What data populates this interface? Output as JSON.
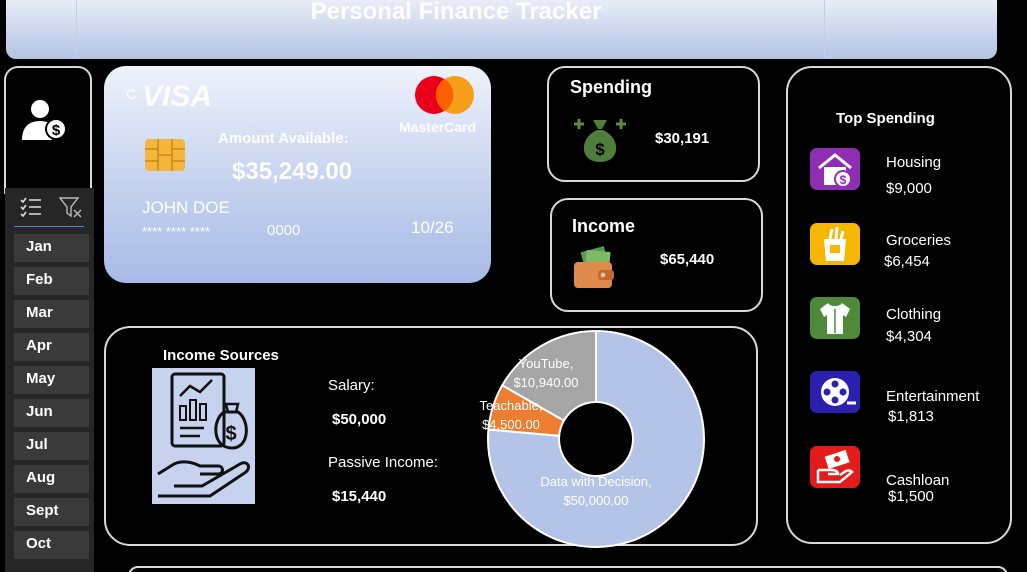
{
  "title": "Personal Finance Tracker",
  "slicer": {
    "items": [
      "Jan",
      "Feb",
      "Mar",
      "Apr",
      "May",
      "Jun",
      "Jul",
      "Aug",
      "Sept",
      "Oct"
    ]
  },
  "card": {
    "brand": "VISA",
    "brand_prefix": "C",
    "network": "MasterCard",
    "amount_label": "Amount Available:",
    "amount": "$35,249.00",
    "holder": "JOHN DOE",
    "number_mask": "**** **** ****",
    "number_last": "0000",
    "expiry": "10/26"
  },
  "spending": {
    "title": "Spending",
    "value": "$30,191",
    "icon": "money-bag-icon"
  },
  "income": {
    "title": "Income",
    "value": "$65,440",
    "icon": "wallet-icon"
  },
  "top_spending": {
    "title": "Top Spending",
    "items": [
      {
        "label": "Housing",
        "value": "$9,000",
        "icon": "house-dollar-icon",
        "color": "#8e2fb3"
      },
      {
        "label": "Groceries",
        "value": "$6,454",
        "icon": "grocery-bag-icon",
        "color": "#f5b700"
      },
      {
        "label": "Clothing",
        "value": "$4,304",
        "icon": "shirt-icon",
        "color": "#4e8a3a"
      },
      {
        "label": "Entertainment",
        "value": "$1,813",
        "icon": "film-reel-icon",
        "color": "#2b1fb0"
      },
      {
        "label": "Cashloan",
        "value": "$1,500",
        "icon": "cash-hand-icon",
        "color": "#e31b1b"
      }
    ]
  },
  "income_sources": {
    "title": "Income Sources",
    "salary_label": "Salary:",
    "salary_value": "$50,000",
    "passive_label": "Passive Income:",
    "passive_value": "$15,440"
  },
  "chart_data": {
    "type": "pie",
    "title": "",
    "slices": [
      {
        "name": "Data with Decision",
        "value": 50000,
        "label_line1": "Data with Decision,",
        "label_line2": "$50,000.00",
        "color": "#b3c4e8"
      },
      {
        "name": "Teachable",
        "value": 4500,
        "label_line1": "Teachable,",
        "label_line2": "$4,500.00",
        "color": "#ed7d31"
      },
      {
        "name": "YouTube",
        "value": 10940,
        "label_line1": "YouTube,",
        "label_line2": "$10,940.00",
        "color": "#a5a5a5"
      }
    ]
  }
}
